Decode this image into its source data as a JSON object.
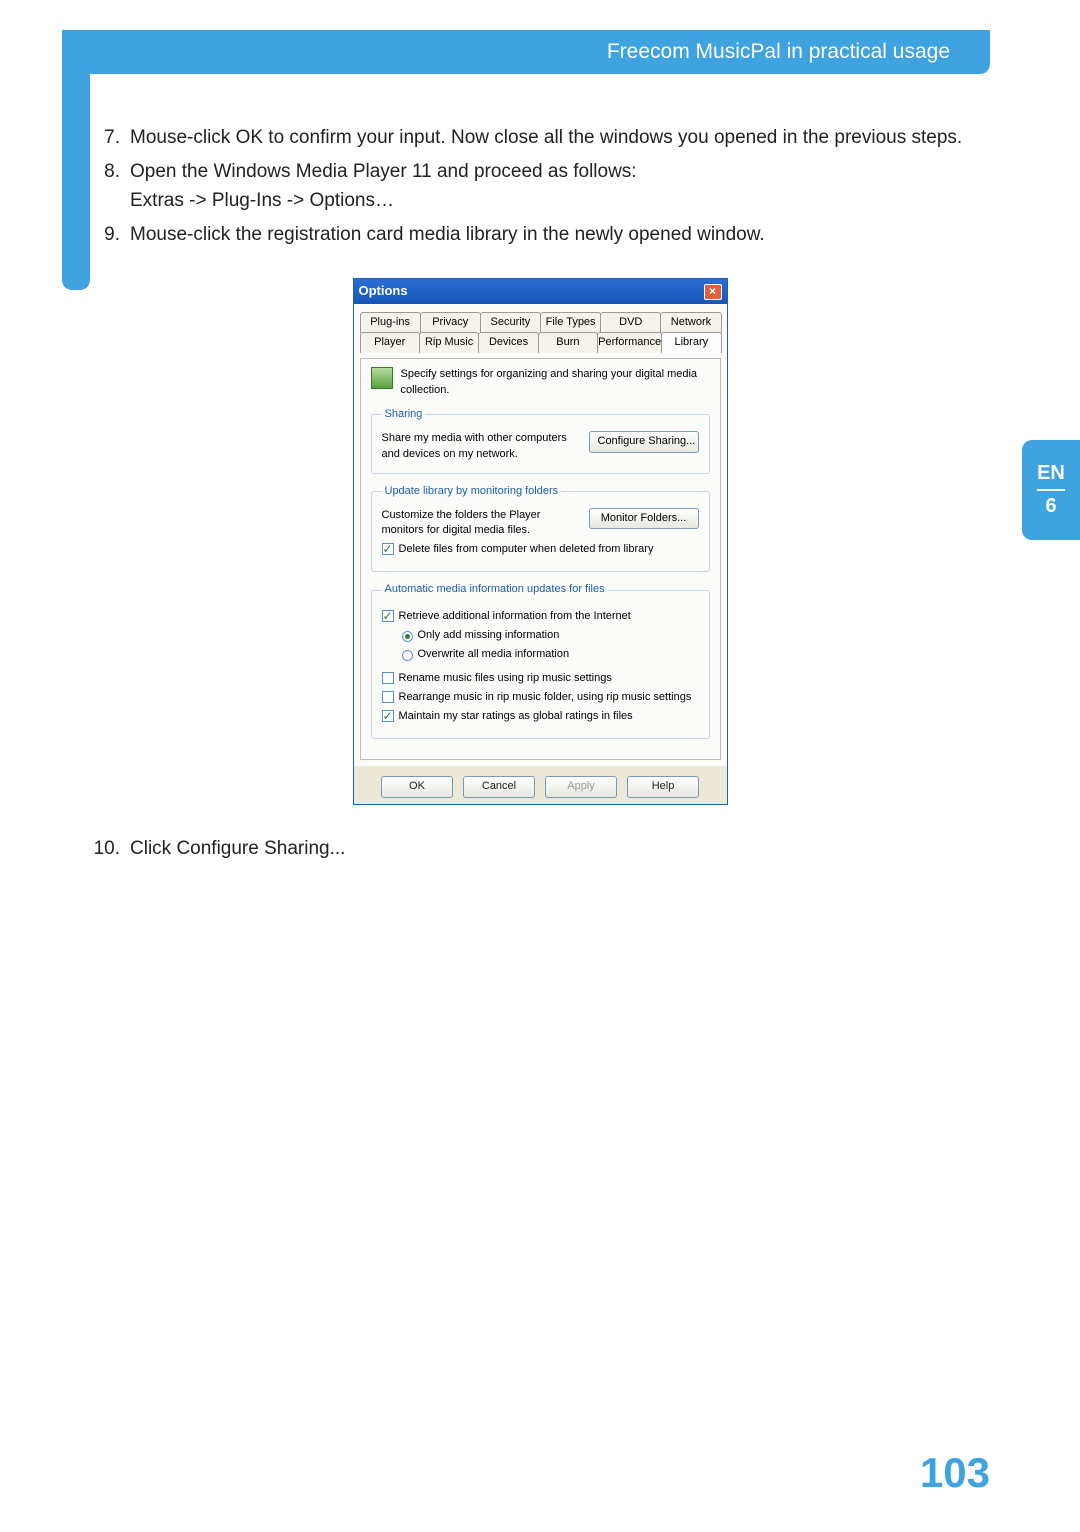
{
  "header": {
    "title": "Freecom MusicPal in practical usage"
  },
  "steps": {
    "s7": {
      "num": "7.",
      "text": "Mouse-click OK to confirm your input. Now close all the windows you opened in the previous steps."
    },
    "s8": {
      "num": "8.",
      "text": "Open the Windows Media Player 11 and proceed as follows:",
      "sub": "Extras -> Plug-Ins -> Options…"
    },
    "s9": {
      "num": "9.",
      "text": "Mouse-click the registration card media library in the newly opened window."
    },
    "s10": {
      "num": "10.",
      "text": "Click Configure Sharing..."
    }
  },
  "dialog": {
    "title": "Options",
    "tabs_row1": [
      "Plug-ins",
      "Privacy",
      "Security",
      "File Types",
      "DVD",
      "Network"
    ],
    "tabs_row2": [
      "Player",
      "Rip Music",
      "Devices",
      "Burn",
      "Performance",
      "Library"
    ],
    "active_tab": "Library",
    "intro": "Specify settings for organizing and sharing your digital media collection.",
    "sharing_legend": "Sharing",
    "sharing_text": "Share my media with other computers and devices on my network.",
    "configure_sharing": "Configure Sharing...",
    "update_legend": "Update library by monitoring folders",
    "update_text": "Customize the folders the Player monitors for digital media files.",
    "monitor_folders": "Monitor Folders...",
    "delete_label": "Delete files from computer when deleted from library",
    "auto_legend": "Automatic media information updates for files",
    "retrieve_label": "Retrieve additional information from the Internet",
    "radio1": "Only add missing information",
    "radio2": "Overwrite all media information",
    "rename_label": "Rename music files using rip music settings",
    "rearrange_label": "Rearrange music in rip music folder, using rip music settings",
    "maintain_label": "Maintain my star ratings as global ratings in files",
    "buttons": {
      "ok": "OK",
      "cancel": "Cancel",
      "apply": "Apply",
      "help": "Help"
    }
  },
  "side": {
    "lang": "EN",
    "chapter": "6"
  },
  "page_number": "103"
}
